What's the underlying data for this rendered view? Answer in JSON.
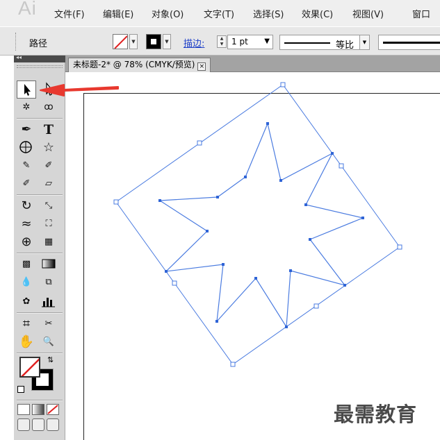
{
  "app": {
    "logo": "Ai"
  },
  "menu": [
    "文件(F)",
    "编辑(E)",
    "对象(O)",
    "文字(T)",
    "选择(S)",
    "效果(C)",
    "视图(V)",
    "窗口"
  ],
  "control_bar": {
    "selection_label": "路径",
    "stroke_label": "描边:",
    "stroke_weight": "1 pt",
    "profile_label": "等比"
  },
  "document": {
    "tab_title": "未标题-2* @ 78% (CMYK/预览)",
    "close_glyph": "×"
  },
  "tools": [
    "selection-tool",
    "direct-selection-tool",
    "magic-wand-tool",
    "lasso-tool",
    "pen-tool",
    "type-tool",
    "line-segment-tool",
    "star-tool",
    "paintbrush-tool",
    "pencil-tool",
    "blob-brush-tool",
    "eraser-tool",
    "rotate-tool",
    "scale-tool",
    "warp-tool",
    "free-transform-tool",
    "shape-builder-tool",
    "perspective-grid-tool",
    "mesh-tool",
    "gradient-tool",
    "eyedropper-tool",
    "blend-tool",
    "symbol-sprayer-tool",
    "column-graph-tool",
    "artboard-tool",
    "slice-tool",
    "hand-tool",
    "zoom-tool"
  ],
  "tool_glyphs": {
    "selection": "➤",
    "direct_selection": "↖",
    "magic_wand": "✲",
    "lasso": "ꝏ",
    "pen": "✒",
    "type": "T",
    "line": "╲",
    "star": "☆",
    "brush": "🖌",
    "pencil": "✎",
    "blob": "✐",
    "eraser": "▱",
    "rotate": "↻",
    "scale": "⤡",
    "warp": "≈",
    "free_transform": "⛶",
    "shape_builder": "⊕",
    "perspective": "▦",
    "mesh": "▩",
    "gradient": "▭",
    "eyedropper": "💧",
    "blend": "⧉",
    "symbol": "✿",
    "graph": "▇",
    "artboard": "⌗",
    "slice": "✂",
    "hand": "✋",
    "zoom": "🔍",
    "swap": "⇅",
    "close_tb": "◂◂"
  },
  "icons": [
    "selection-tool-icon",
    "red-arrow-annotation",
    "stroke-color-icon",
    "fill-swatch-icon"
  ],
  "colors": {
    "path_blue": "#4a7be0",
    "anchor_fill": "#2f64d6",
    "annotation_red": "#e8392f",
    "menubar_bg": "#efefef",
    "toolbox_bg": "#d6d6d6"
  },
  "watermark": "最需教育"
}
